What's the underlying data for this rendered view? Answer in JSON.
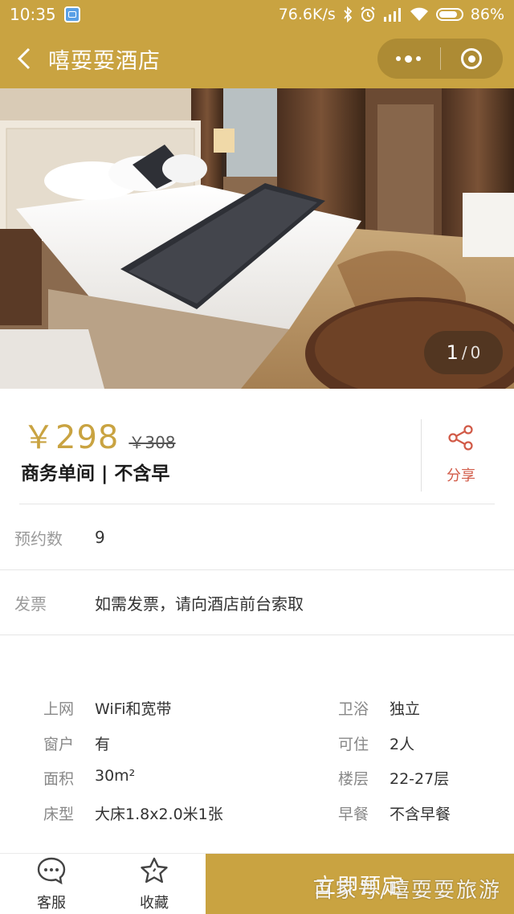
{
  "status_bar": {
    "time": "10:35",
    "network_speed": "76.6K/s",
    "battery": "86%",
    "battery_level": 0.86,
    "icons": [
      "app-badge-icon",
      "bluetooth-icon",
      "alarm-icon",
      "signal-icon",
      "wifi-icon",
      "battery-icon"
    ]
  },
  "nav": {
    "title": "嘻耍耍酒店",
    "back_icon": "chevron-left-icon",
    "menu_icon": "more-dots-icon",
    "close_icon": "target-circle-icon"
  },
  "gallery": {
    "current": "1",
    "separator": "/",
    "total": "0"
  },
  "room": {
    "price": "￥298",
    "original_price": "￥308",
    "name": "商务单间 | 不含早",
    "share_label": "分享",
    "share_icon": "share-icon"
  },
  "info": {
    "bookings_label": "预约数",
    "bookings_value": "9",
    "invoice_label": "发票",
    "invoice_value": "如需发票，请向酒店前台索取"
  },
  "facilities": [
    {
      "left_label": "上网",
      "left_value": "WiFi和宽带",
      "right_label": "卫浴",
      "right_value": "独立"
    },
    {
      "left_label": "窗户",
      "left_value": "有",
      "right_label": "可住",
      "right_value": "2人"
    },
    {
      "left_label": "面积",
      "left_value": "30m²",
      "right_label": "楼层",
      "right_value": "22-27层"
    },
    {
      "left_label": "床型",
      "left_value": "大床1.8x2.0米1张",
      "right_label": "早餐",
      "right_value": "不含早餐"
    }
  ],
  "bottom_bar": {
    "service_label": "客服",
    "service_icon": "chat-bubble-icon",
    "favorite_label": "收藏",
    "favorite_icon": "star-icon",
    "book_label": "立即预定",
    "watermark": "百家号/嘻耍耍旅游"
  },
  "colors": {
    "brand": "#c9a341",
    "share_red": "#d15a47"
  }
}
